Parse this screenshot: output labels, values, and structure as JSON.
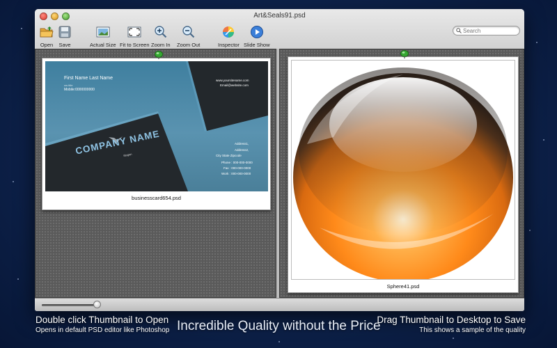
{
  "window": {
    "title": "Art&Seals91.psd"
  },
  "toolbar": {
    "open_label": "Open",
    "save_label": "Save",
    "actual_size_label": "Actual Size",
    "fit_to_screen_label": "Fit to Screen",
    "zoom_in_label": "Zoom In",
    "zoom_out_label": "Zoom Out",
    "inspector_label": "Inspector",
    "slide_show_label": "Slide Show"
  },
  "search": {
    "placeholder": "Search"
  },
  "thumbnails": [
    {
      "filename": "businesscard654.psd"
    },
    {
      "filename": "Sphere41.psd"
    }
  ],
  "card": {
    "name": "First Name Last Name",
    "role": "ow title",
    "mobile": "Mobile:0000000000",
    "website": "www.yoursitename.com",
    "email": "Email@website.com",
    "company": "COMPANY NAME",
    "slogan": "Slogan",
    "address1": "Address1,",
    "address2": "Address2,",
    "city_line": "City    State    Zipcode",
    "phone": "Phone : 000-000-0000",
    "fax": "Fax : 000-000-0000",
    "work": "Work : 000-000-0000"
  },
  "zoom_slider": {
    "value": 0.95
  },
  "promo": {
    "left_title": "Double click Thumbnail to Open",
    "left_sub": "Opens in default PSD editor like Photoshop",
    "center": "Incredible Quality without the Price",
    "right_title": "Drag Thumbnail to Desktop to Save",
    "right_sub": "This shows a sample of the quality"
  },
  "colors": {
    "background": "#0f2550",
    "card_blue": "#4a8aa8",
    "card_dark": "#1f2326",
    "sphere_orange": "#ff8a1a",
    "pin_green": "#36a832"
  }
}
